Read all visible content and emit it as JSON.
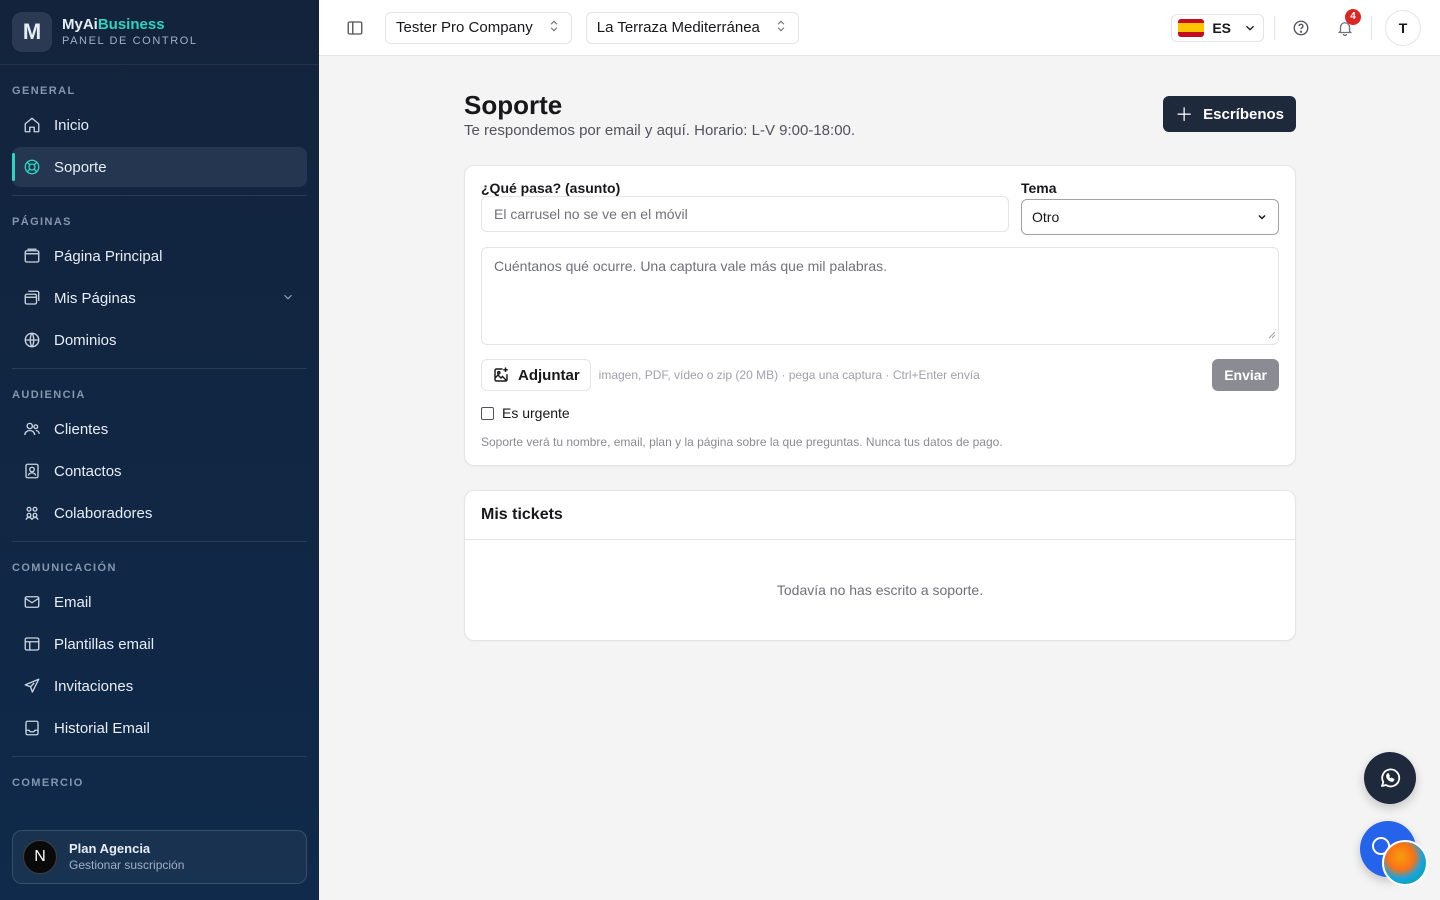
{
  "brand": {
    "name_part1": "MyAi",
    "name_part2": "Business",
    "subtitle": "PANEL DE CONTROL",
    "logo_letter": "M"
  },
  "sidebar": {
    "sections": [
      {
        "title": "GENERAL",
        "items": [
          {
            "label": "Inicio",
            "icon": "home-icon",
            "active": false
          },
          {
            "label": "Soporte",
            "icon": "lifebuoy-icon",
            "active": true
          }
        ]
      },
      {
        "title": "PÁGINAS",
        "items": [
          {
            "label": "Página Principal",
            "icon": "browser-window-icon"
          },
          {
            "label": "Mis Páginas",
            "icon": "pages-icon",
            "expandable": true
          },
          {
            "label": "Dominios",
            "icon": "globe-icon"
          }
        ]
      },
      {
        "title": "AUDIENCIA",
        "items": [
          {
            "label": "Clientes",
            "icon": "users-icon"
          },
          {
            "label": "Contactos",
            "icon": "contact-book-icon"
          },
          {
            "label": "Colaboradores",
            "icon": "team-icon"
          }
        ]
      },
      {
        "title": "COMUNICACIÓN",
        "items": [
          {
            "label": "Email",
            "icon": "mail-icon"
          },
          {
            "label": "Plantillas email",
            "icon": "template-icon"
          },
          {
            "label": "Invitaciones",
            "icon": "send-icon"
          },
          {
            "label": "Historial Email",
            "icon": "inbox-icon"
          }
        ]
      },
      {
        "title": "COMERCIO",
        "items": []
      }
    ],
    "plan": {
      "avatar_letter": "N",
      "name": "Plan Agencia",
      "subtitle": "Gestionar suscripción"
    }
  },
  "topbar": {
    "company": "Tester Pro Company",
    "site": "La Terraza Mediterránea",
    "language": "ES",
    "notifications_count": "4",
    "user_initial": "T"
  },
  "page": {
    "title": "Soporte",
    "subtitle": "Te respondemos por email y aquí. Horario: L-V 9:00-18:00.",
    "new_button": "Escríbenos"
  },
  "form": {
    "subject_label": "¿Qué pasa? (asunto)",
    "subject_placeholder": "El carrusel no se ve en el móvil",
    "topic_label": "Tema",
    "topic_value": "Otro",
    "message_placeholder": "Cuéntanos qué ocurre. Una captura vale más que mil palabras.",
    "attach_label": "Adjuntar",
    "attach_hint": "imagen, PDF, vídeo o zip (20 MB) · pega una captura · Ctrl+Enter envía",
    "send_label": "Enviar",
    "urgent_label": "Es urgente",
    "privacy_note": "Soporte verá tu nombre, email, plan y la página sobre la que preguntas. Nunca tus datos de pago."
  },
  "tickets": {
    "title": "Mis tickets",
    "empty": "Todavía no has escrito a soporte."
  },
  "colors": {
    "sidebar_bg": "#13233c",
    "accent": "#2dd4bf",
    "primary_button": "#1e293b",
    "badge": "#dc2626",
    "chat_fab": "#2563eb"
  }
}
